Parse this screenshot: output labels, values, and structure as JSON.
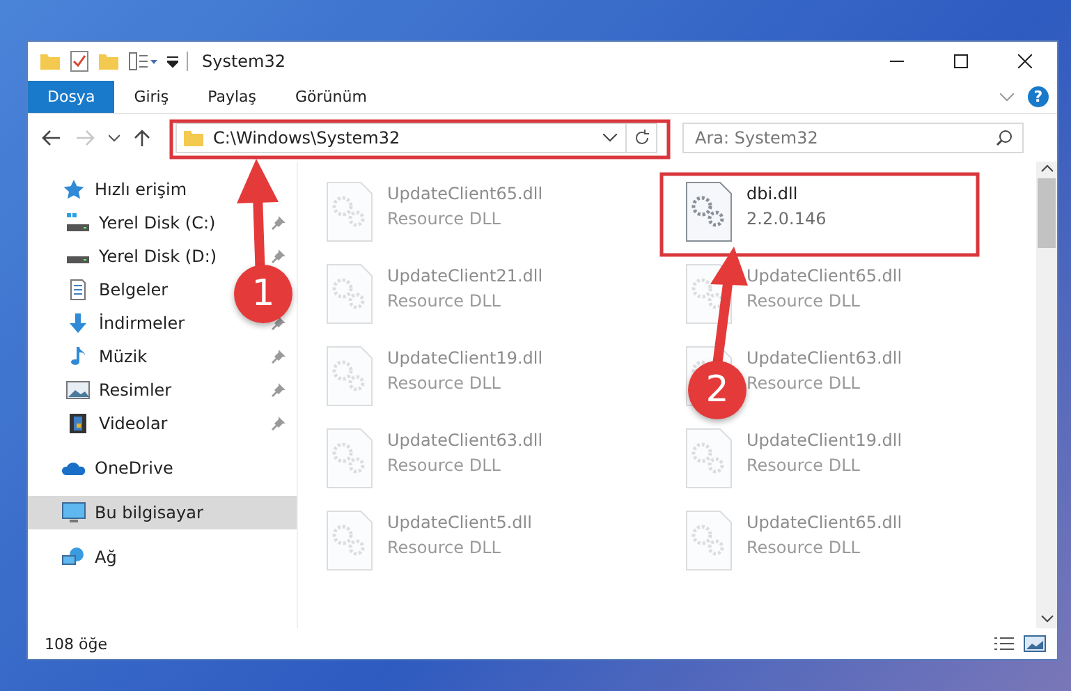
{
  "window": {
    "title": "System32"
  },
  "ribbon": {
    "tabs": [
      {
        "label": "Dosya",
        "selected": true
      },
      {
        "label": "Giriş",
        "selected": false
      },
      {
        "label": "Paylaş",
        "selected": false
      },
      {
        "label": "Görünüm",
        "selected": false
      }
    ],
    "help": "?"
  },
  "address_bar": {
    "forward_disabled": true,
    "path": "C:\\Windows\\System32",
    "search_placeholder": "Ara: System32"
  },
  "sidebar": {
    "items": [
      {
        "label": "Hızlı erişim",
        "kind": "star",
        "selected": false,
        "children": [
          {
            "label": "Yerel Disk (C:)",
            "kind": "disk-c",
            "pinned": true
          },
          {
            "label": "Yerel Disk (D:)",
            "kind": "disk",
            "pinned": true
          },
          {
            "label": "Belgeler",
            "kind": "docs",
            "pinned": false
          },
          {
            "label": "İndirmeler",
            "kind": "download",
            "pinned": true
          },
          {
            "label": "Müzik",
            "kind": "music",
            "pinned": true
          },
          {
            "label": "Resimler",
            "kind": "pictures",
            "pinned": true
          },
          {
            "label": "Videolar",
            "kind": "video",
            "pinned": true
          }
        ]
      },
      {
        "label": "OneDrive",
        "kind": "cloud",
        "selected": false
      },
      {
        "label": "Bu bilgisayar",
        "kind": "pc",
        "selected": true
      },
      {
        "label": "Ağ",
        "kind": "network",
        "selected": false
      }
    ]
  },
  "files": [
    {
      "name": "UpdateClient65.dll",
      "detail": "Resource DLL",
      "blurred": true
    },
    {
      "name": "dbi.dll",
      "detail": "2.2.0.146",
      "blurred": false
    },
    {
      "name": "UpdateClient21.dll",
      "detail": "Resource DLL",
      "blurred": true
    },
    {
      "name": "UpdateClient65.dll",
      "detail": "Resource DLL",
      "blurred": true
    },
    {
      "name": "UpdateClient19.dll",
      "detail": "Resource DLL",
      "blurred": true
    },
    {
      "name": "UpdateClient63.dll",
      "detail": "Resource DLL",
      "blurred": true
    },
    {
      "name": "UpdateClient63.dll",
      "detail": "Resource DLL",
      "blurred": true
    },
    {
      "name": "UpdateClient19.dll",
      "detail": "Resource DLL",
      "blurred": true
    },
    {
      "name": "UpdateClient5.dll",
      "detail": "Resource DLL",
      "blurred": true
    },
    {
      "name": "UpdateClient65.dll",
      "detail": "Resource DLL",
      "blurred": true
    }
  ],
  "status_bar": {
    "count": "108 öğe"
  },
  "callouts": [
    {
      "number": "1"
    },
    {
      "number": "2"
    }
  ]
}
